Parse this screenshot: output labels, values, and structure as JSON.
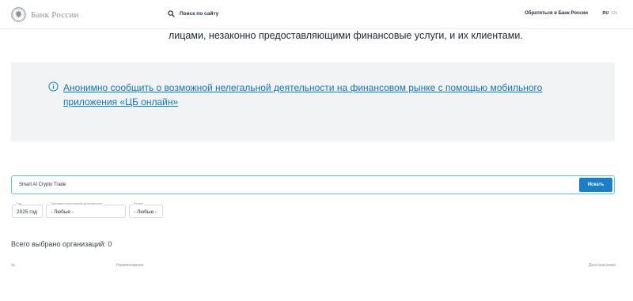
{
  "header": {
    "logo_text": "Банк России",
    "search_label": "Поиск по сайту",
    "contact_label": "Обратиться в Банк России",
    "lang_ru": "RU",
    "lang_en": "EN"
  },
  "intro": {
    "text": "лицами, незаконно предоставляющими финансовые услуги, и их клиентами."
  },
  "notice": {
    "link_text": "Анонимно сообщить о возможной нелегальной деятельности на финансовом рынке с помощью мобильного приложения «ЦБ онлайн»",
    "accent": "#0a7ac2",
    "background": "#f1f3f4"
  },
  "search": {
    "value": "Smart AI Crypto Trade",
    "button_label": "Искать",
    "button_color": "#1a7ec9",
    "border_color": "#5ec7d6"
  },
  "filters": [
    {
      "label": "Год",
      "value": "2025 год"
    },
    {
      "label": "Признаки нелегальной деятельности",
      "value": "- Любые -"
    },
    {
      "label": "Регион",
      "value": "- Любые -"
    }
  ],
  "results": {
    "total_text": "Всего выбрано организаций: 0",
    "columns": [
      "№",
      "Наименование",
      "Дата внесения"
    ]
  },
  "icons": [
    "bank-emblem-icon",
    "search-icon",
    "info-icon"
  ]
}
